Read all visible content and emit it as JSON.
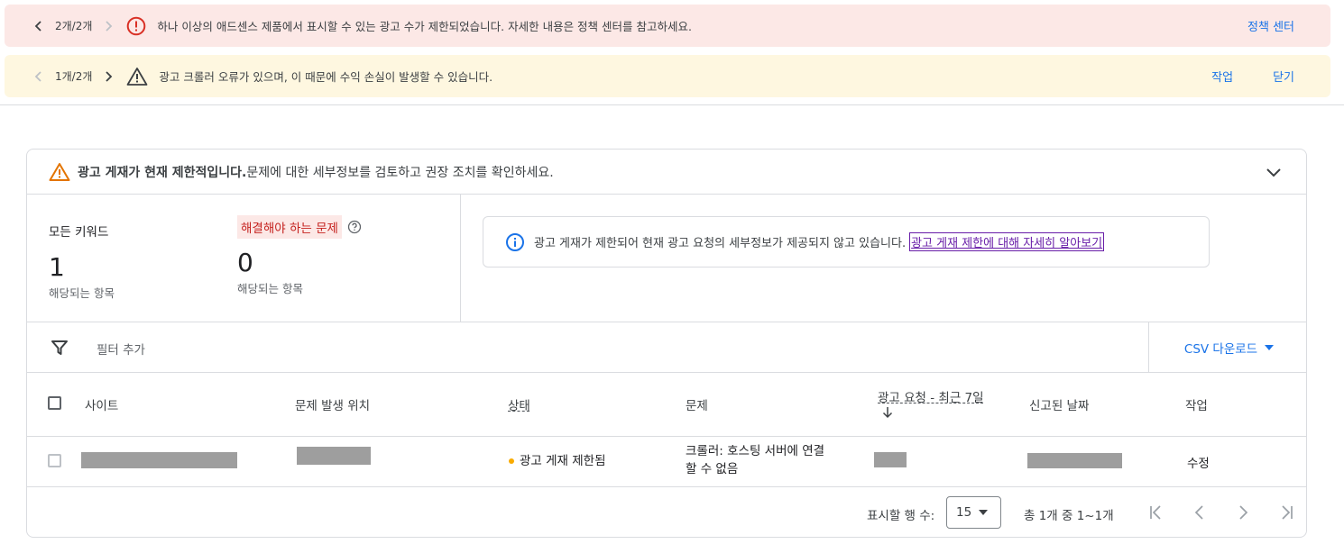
{
  "banners": [
    {
      "count": "2개/2개",
      "message": "하나 이상의 애드센스 제품에서 표시할 수 있는 광고 수가 제한되었습니다. 자세한 내용은 정책 센터를 참고하세요.",
      "actions": [
        "정책 센터"
      ],
      "icon": "error-icon",
      "color": "#d93025"
    },
    {
      "count": "1개/2개",
      "message": "광고 크롤러 오류가 있으며, 이 때문에 수익 손실이 발생할 수 있습니다.",
      "actions": [
        "작업",
        "닫기"
      ],
      "icon": "warning-icon",
      "color": "#3c4043"
    }
  ],
  "card": {
    "title": "광고 게재가 현재 제한적입니다.",
    "subtitle": " 문제에 대한 세부정보를 검토하고 권장 조치를 확인하세요.",
    "stats": [
      {
        "label": "모든 키워드",
        "value": "1",
        "sub": "해당되는 항목"
      },
      {
        "label": "해결해야 하는 문제",
        "value": "0",
        "sub": "해당되는 항목"
      }
    ],
    "info": {
      "text": "광고 게재가 제한되어 현재 광고 요청의 세부정보가 제공되지 않고 있습니다.",
      "link": "광고 게재 제한에 대해 자세히 알아보기"
    },
    "filter_placeholder": "필터 추가",
    "csv_label": "CSV 다운로드",
    "columns": [
      "사이트",
      "문제 발생 위치",
      "상태",
      "문제",
      "광고 요청 - 최근 7일",
      "신고된 날짜",
      "작업"
    ],
    "rows": [
      {
        "status": "광고 게재 제한됨",
        "issue_line1": "크롤러: 호스팅 서버에 연결",
        "issue_line2": "할 수 없음",
        "action": "수정"
      }
    ],
    "footer": {
      "rows_label": "표시할 행 수:",
      "rows_value": "15",
      "range": "총 1개 중 1~1개"
    }
  },
  "colors": {
    "accent": "#1a73e8",
    "warning": "#e37400",
    "status_dot": "#f9ab00"
  }
}
